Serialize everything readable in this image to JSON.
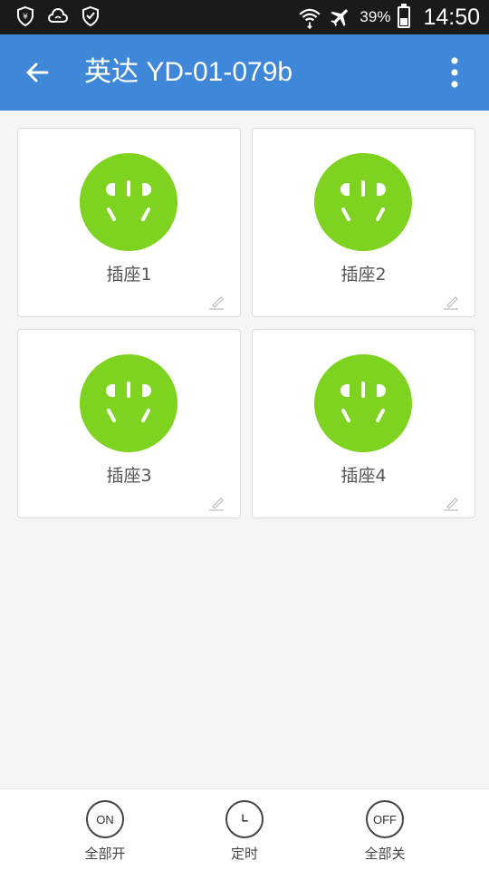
{
  "status_bar": {
    "battery_percent": "39%",
    "time": "14:50",
    "icons": [
      "shield-yen-icon",
      "wifi-cloud-icon",
      "shield-check-icon",
      "wifi-icon",
      "airplane-icon",
      "battery-icon"
    ]
  },
  "toolbar": {
    "title": "英达 YD-01-079b",
    "back_icon": "arrow-left-icon",
    "menu_icon": "more-vert-icon"
  },
  "outlets": [
    {
      "label": "插座1",
      "color": "#7ed321"
    },
    {
      "label": "插座2",
      "color": "#7ed321"
    },
    {
      "label": "插座3",
      "color": "#7ed321"
    },
    {
      "label": "插座4",
      "color": "#7ed321"
    }
  ],
  "bottom_bar": {
    "all_on": {
      "icon_text": "ON",
      "label": "全部开"
    },
    "timer": {
      "label": "定时",
      "icon": "clock-icon"
    },
    "all_off": {
      "icon_text": "OFF",
      "label": "全部关"
    }
  },
  "colors": {
    "toolbar": "#3f87d8",
    "socket_on": "#7ed321"
  }
}
